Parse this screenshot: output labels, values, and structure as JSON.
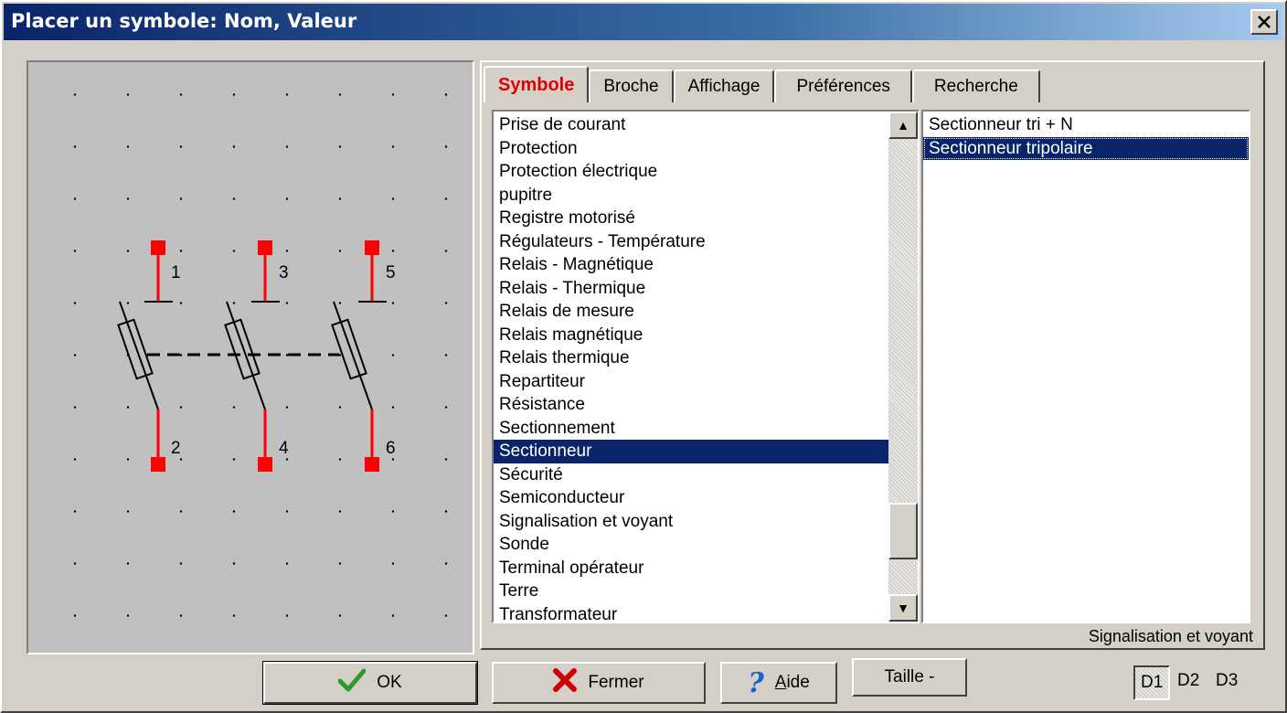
{
  "window": {
    "title": "Placer un symbole: Nom, Valeur",
    "close_glyph": "✕"
  },
  "preview": {
    "pin_labels": [
      "1",
      "3",
      "5",
      "2",
      "4",
      "6"
    ],
    "symbol_color": "#ff0000"
  },
  "tabs": [
    {
      "label": "Symbole",
      "active": true
    },
    {
      "label": "Broche",
      "active": false
    },
    {
      "label": "Affichage",
      "active": false
    },
    {
      "label": "Préférences",
      "active": false
    },
    {
      "label": "Recherche",
      "active": false
    }
  ],
  "category_list": {
    "items": [
      "Prise de courant",
      "Protection",
      "Protection électrique",
      "pupitre",
      "Registre motorisé",
      "Régulateurs - Température",
      "Relais - Magnétique",
      "Relais - Thermique",
      "Relais de mesure",
      "Relais magnétique",
      "Relais thermique",
      "Repartiteur",
      "Résistance",
      "Sectionnement",
      "Sectionneur",
      "Sécurité",
      "Semiconducteur",
      "Signalisation et voyant",
      "Sonde",
      "Terminal opérateur",
      "Terre",
      "Transformateur"
    ],
    "selected": "Sectionneur"
  },
  "symbol_list": {
    "items": [
      "Sectionneur tri + N",
      "Sectionneur tripolaire"
    ],
    "selected": "Sectionneur tripolaire"
  },
  "status_text": "Signalisation et voyant",
  "buttons": {
    "ok": "OK",
    "close": "Fermer",
    "help_first": "A",
    "help_rest": "ide",
    "size": "Taille -"
  },
  "detail_levels": [
    "D1",
    "D2",
    "D3"
  ],
  "detail_selected": "D1",
  "colors": {
    "accent_tab": "#e00000",
    "selection": "#0a246a",
    "ok_check": "#2e9a2e",
    "close_x": "#cc0000",
    "help_q": "#1c5fd4"
  }
}
